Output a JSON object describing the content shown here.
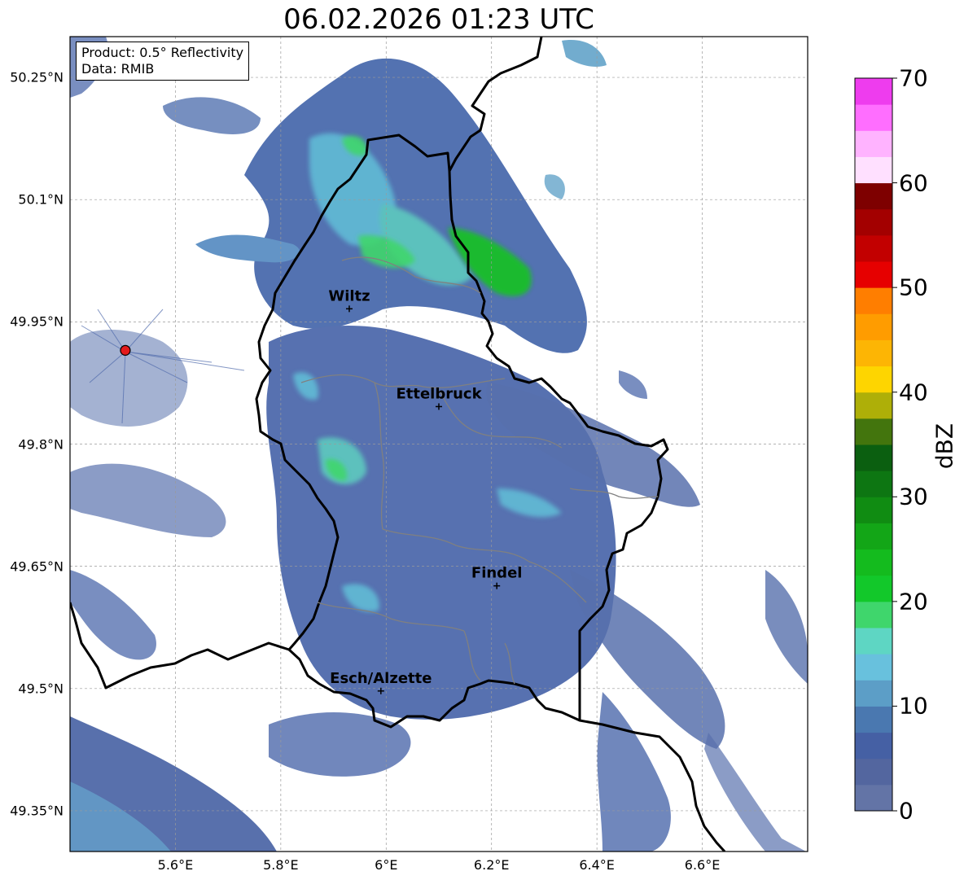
{
  "map": {
    "title": "06.02.2026 01:23 UTC",
    "info_box": {
      "product": "Product: 0.5° Reflectivity",
      "data_source": "Data: RMIB"
    },
    "lat_ticks": [
      {
        "value": 50.25,
        "label": "50.25°N"
      },
      {
        "value": 50.1,
        "label": "50.1°N"
      },
      {
        "value": 49.95,
        "label": "49.95°N"
      },
      {
        "value": 49.8,
        "label": "49.8°N"
      },
      {
        "value": 49.65,
        "label": "49.65°N"
      },
      {
        "value": 49.5,
        "label": "49.5°N"
      },
      {
        "value": 49.35,
        "label": "49.35°N"
      }
    ],
    "lon_ticks": [
      {
        "value": 5.6,
        "label": "5.6°E"
      },
      {
        "value": 5.8,
        "label": "5.8°E"
      },
      {
        "value": 6.0,
        "label": "6°E"
      },
      {
        "value": 6.2,
        "label": "6.2°E"
      },
      {
        "value": 6.4,
        "label": "6.4°E"
      },
      {
        "value": 6.6,
        "label": "6.6°E"
      }
    ],
    "extent": {
      "lon_min": 5.4,
      "lon_max": 6.8,
      "lat_min": 49.3,
      "lat_max": 50.3
    },
    "cities": [
      {
        "name": "Wiltz",
        "lon": 5.93,
        "lat": 49.966
      },
      {
        "name": "Ettelbruck",
        "lon": 6.1,
        "lat": 49.846
      },
      {
        "name": "Findel",
        "lon": 6.21,
        "lat": 49.626
      },
      {
        "name": "Esch/Alzette",
        "lon": 5.99,
        "lat": 49.497
      }
    ],
    "radar_site": {
      "lon": 5.505,
      "lat": 49.915
    }
  },
  "colorbar": {
    "label": "dBZ",
    "min": 0,
    "max": 70,
    "ticks": [
      {
        "value": 0,
        "label": "0"
      },
      {
        "value": 10,
        "label": "10"
      },
      {
        "value": 20,
        "label": "20"
      },
      {
        "value": 30,
        "label": "30"
      },
      {
        "value": 40,
        "label": "40"
      },
      {
        "value": 50,
        "label": "50"
      },
      {
        "value": 60,
        "label": "60"
      },
      {
        "value": 70,
        "label": "70"
      }
    ],
    "colors": [
      "#6374a6",
      "#53669f",
      "#4560a4",
      "#4a78b0",
      "#5c9ec7",
      "#68c1dd",
      "#5ed6c3",
      "#3fd66c",
      "#12c82a",
      "#14bb1e",
      "#13a617",
      "#108c12",
      "#0d7612",
      "#0b5f10",
      "#43750d",
      "#aeaf08",
      "#fed500",
      "#fdb504",
      "#ff9c00",
      "#ff7e00",
      "#e60000",
      "#c20000",
      "#a30000",
      "#7e0000",
      "#ffe0ff",
      "#ffb3ff",
      "#ff6eff",
      "#ee3cee"
    ]
  }
}
